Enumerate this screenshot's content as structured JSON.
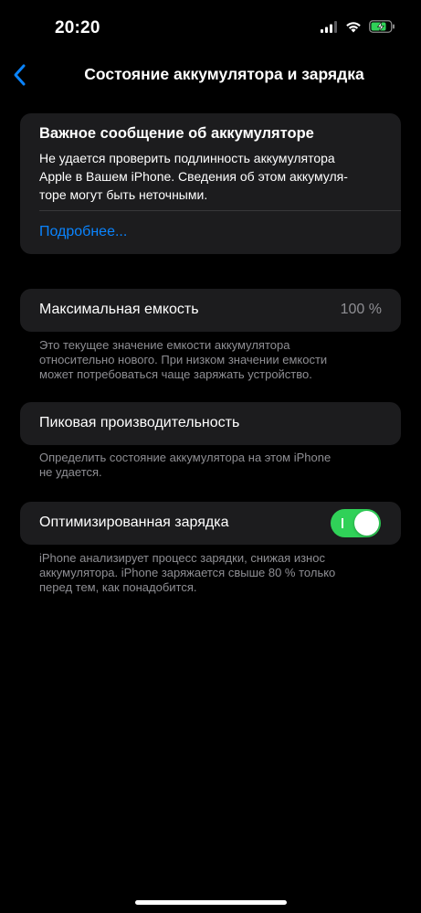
{
  "status_bar": {
    "time": "20:20",
    "icons": [
      "cellular-signal-icon",
      "wifi-icon",
      "battery-charging-icon"
    ]
  },
  "nav": {
    "back_icon": "chevron-left-icon",
    "title": "Состояние аккумулятора и зарядка"
  },
  "notice": {
    "title": "Важное сообщение об аккумуляторе",
    "lines": [
      "Не удается проверить подлинность аккумулятора",
      "Apple в Вашем iPhone. Сведения об этом аккумуля-",
      "торе могут быть неточными."
    ],
    "link": "Подробнее..."
  },
  "capacity": {
    "label": "Максимальная емкость",
    "value": "100 %",
    "footer": [
      "Это текущее значение емкости аккумулятора",
      "относительно нового. При низком значении емкости",
      "может потребоваться чаще заряжать устройство."
    ]
  },
  "peak": {
    "label": "Пиковая производительность",
    "footer": [
      "Определить состояние аккумулятора на этом iPhone",
      "не удается."
    ]
  },
  "optimized": {
    "label": "Оптимизированная зарядка",
    "enabled": true,
    "footer": [
      "iPhone анализирует процесс зарядки, снижая износ",
      "аккумулятора. iPhone заряжается свыше 80 % только",
      "перед тем, как понадобится."
    ]
  },
  "colors": {
    "accent": "#0a84ff",
    "toggle_on": "#30d158",
    "card_bg": "#1c1c1e",
    "secondary_text": "#8e8e93"
  }
}
